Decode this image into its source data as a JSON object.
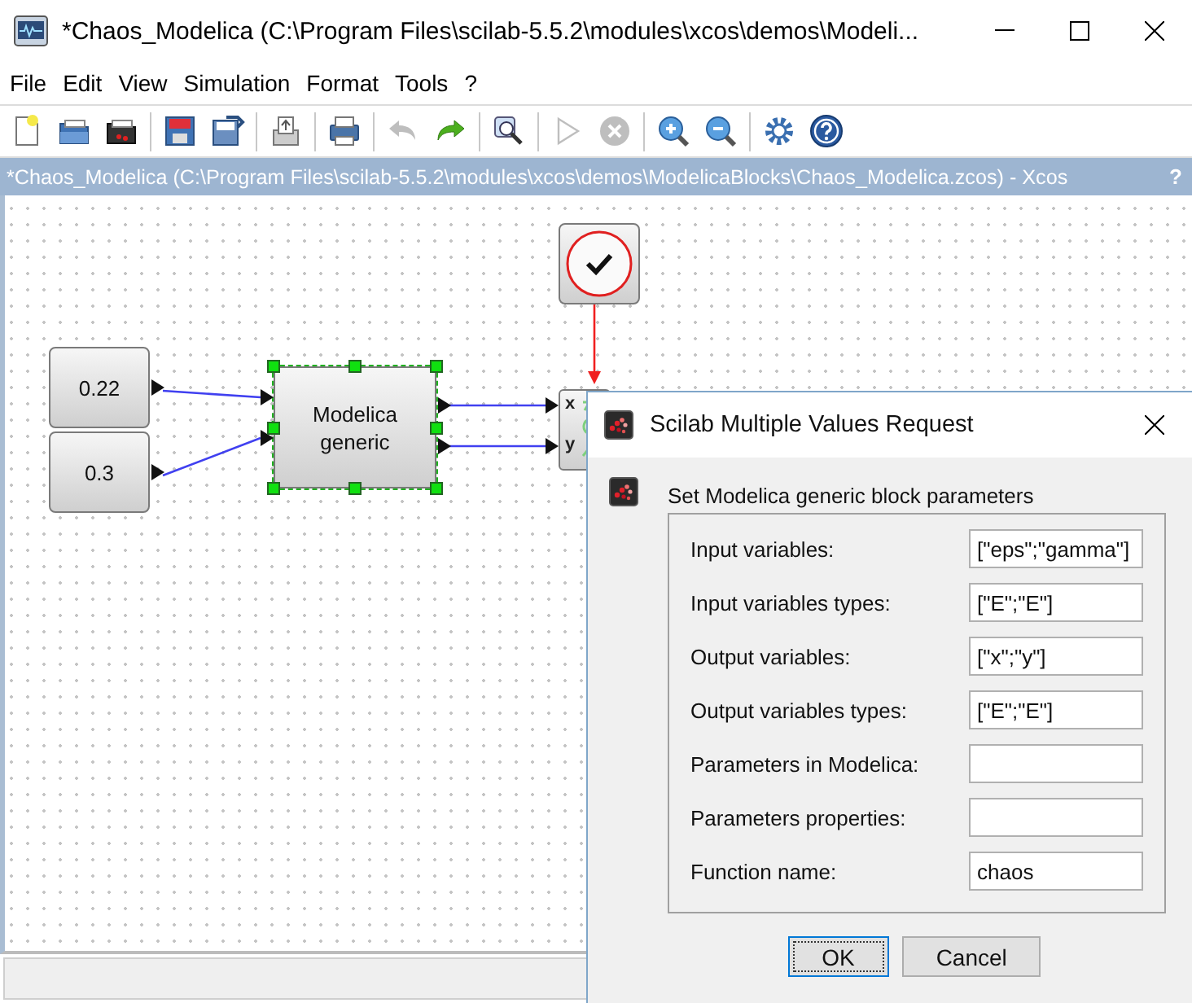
{
  "window": {
    "title": "*Chaos_Modelica (C:\\Program Files\\scilab-5.5.2\\modules\\xcos\\demos\\Modeli..."
  },
  "menu": [
    "File",
    "Edit",
    "View",
    "Simulation",
    "Format",
    "Tools",
    "?"
  ],
  "toolbar": [
    [
      {
        "kind": "new",
        "disabled": false
      },
      {
        "kind": "open",
        "disabled": false
      },
      {
        "kind": "open-scilab",
        "disabled": false
      }
    ],
    [
      {
        "kind": "save",
        "disabled": false
      },
      {
        "kind": "save-as",
        "disabled": false
      }
    ],
    [
      {
        "kind": "export",
        "disabled": false
      }
    ],
    [
      {
        "kind": "print",
        "disabled": false
      }
    ],
    [
      {
        "kind": "undo",
        "disabled": true
      },
      {
        "kind": "redo",
        "disabled": false
      }
    ],
    [
      {
        "kind": "fit",
        "disabled": false
      }
    ],
    [
      {
        "kind": "start",
        "disabled": true
      },
      {
        "kind": "stop",
        "disabled": true
      }
    ],
    [
      {
        "kind": "zoom-in",
        "disabled": false
      },
      {
        "kind": "zoom-out",
        "disabled": false
      }
    ],
    [
      {
        "kind": "settings",
        "disabled": false
      },
      {
        "kind": "help",
        "disabled": false
      }
    ]
  ],
  "document_bar": {
    "title": "*Chaos_Modelica (C:\\Program Files\\scilab-5.5.2\\modules\\xcos\\demos\\ModelicaBlocks\\Chaos_Modelica.zcos) - Xcos",
    "help": "?"
  },
  "diagram": {
    "blocks": [
      {
        "kind": "constant",
        "label": "0.22",
        "selected": false
      },
      {
        "kind": "constant",
        "label": "0.3",
        "selected": false
      },
      {
        "kind": "modelica",
        "label": "Modelica generic",
        "selected": true
      },
      {
        "kind": "clock",
        "selected": false
      },
      {
        "kind": "scope",
        "ports": [
          "x",
          "y"
        ],
        "selected": false
      }
    ]
  },
  "dialog": {
    "title": "Scilab Multiple Values Request",
    "message": "Set Modelica generic block parameters",
    "fields": [
      {
        "label": "Input variables:",
        "value": "[\"eps\";\"gamma\"]"
      },
      {
        "label": "Input variables types:",
        "value": "[\"E\";\"E\"]"
      },
      {
        "label": "Output variables:",
        "value": "[\"x\";\"y\"]"
      },
      {
        "label": "Output variables types:",
        "value": "[\"E\";\"E\"]"
      },
      {
        "label": "Parameters in Modelica:"
      },
      {
        "label": "Parameters properties:"
      },
      {
        "label": "Function name:",
        "value": "chaos"
      }
    ],
    "buttons": [
      {
        "label": "OK",
        "focused": true
      },
      {
        "label": "Cancel",
        "focused": false
      }
    ]
  }
}
